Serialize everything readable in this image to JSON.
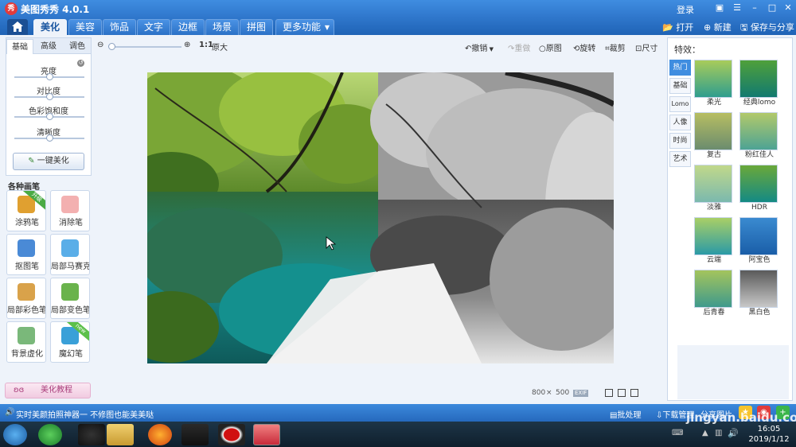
{
  "app": {
    "title": "美图秀秀 4.0.1",
    "logo_text": "秀",
    "login": "登录"
  },
  "nav": {
    "tabs": [
      "美化",
      "美容",
      "饰品",
      "文字",
      "边框",
      "场景",
      "拼图",
      "更多功能"
    ],
    "open": "打开",
    "new": "新建",
    "save": "保存与分享"
  },
  "adjust": {
    "subtabs": [
      "基础",
      "高级",
      "调色"
    ],
    "sliders": [
      {
        "label": "亮度",
        "value": 0.5
      },
      {
        "label": "对比度",
        "value": 0.5
      },
      {
        "label": "色彩饱和度",
        "value": 0.5
      },
      {
        "label": "清晰度",
        "value": 0.5
      }
    ],
    "one_click": "一键美化"
  },
  "brushes": {
    "title": "各种画笔",
    "items": [
      {
        "label": "涂鸦笔",
        "ribbon": "升级",
        "color": "#e0a030"
      },
      {
        "label": "消除笔",
        "ribbon": "",
        "color": "#f3b0b0"
      },
      {
        "label": "抠图笔",
        "ribbon": "",
        "color": "#4a8ad6"
      },
      {
        "label": "局部马赛克",
        "ribbon": "",
        "color": "#5aaee8"
      },
      {
        "label": "局部彩色笔",
        "ribbon": "",
        "color": "#d9a24a"
      },
      {
        "label": "局部变色笔",
        "ribbon": "",
        "color": "#6ab34c"
      },
      {
        "label": "背景虚化",
        "ribbon": "",
        "color": "#7ab87a"
      },
      {
        "label": "魔幻笔",
        "ribbon": "new",
        "color": "#3aa0d8"
      }
    ]
  },
  "tutorial": "美化教程",
  "toolbar": {
    "zoom_ratio": "1:1",
    "original_size": "原大",
    "undo": "撤销",
    "redo": "重做",
    "original": "原图",
    "rotate": "旋转",
    "crop": "裁剪",
    "resize": "尺寸",
    "zoom_value": 0.0
  },
  "image_info": {
    "width": "800",
    "times": "×",
    "height": "500",
    "exif": "EXIF"
  },
  "effects": {
    "title": "特效：",
    "categories": [
      "热门",
      "基础",
      "Lomo",
      "人像",
      "时尚",
      "艺术"
    ],
    "items": [
      "柔光",
      "经典lomo",
      "复古",
      "粉红佳人",
      "淡雅",
      "HDR",
      "云端",
      "阿宝色",
      "后青春",
      "黑白色"
    ]
  },
  "status": {
    "tip": "实时美颜拍照神器一 不修图也能美美哒",
    "batch": "批处理",
    "download": "下载管理",
    "share": "分享图片"
  },
  "taskbar": {
    "time": "16:05",
    "date": "2019/1/12"
  },
  "watermark": "jingyan.baidu.com"
}
